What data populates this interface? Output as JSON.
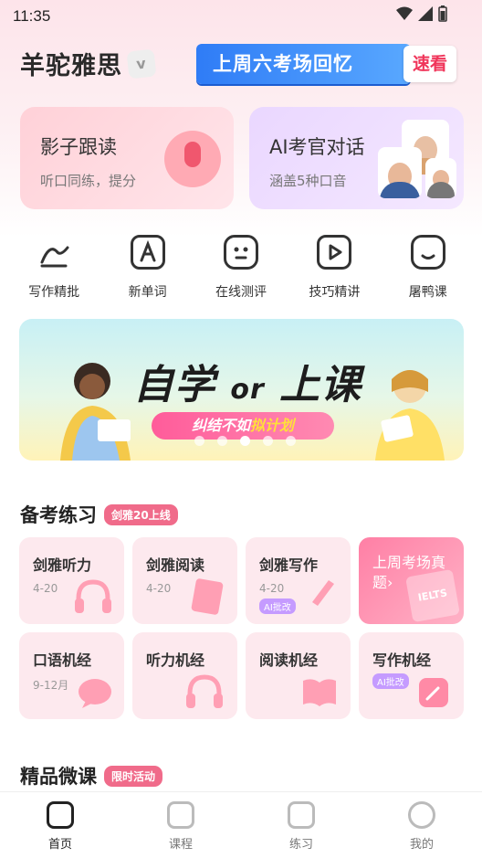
{
  "status": {
    "time": "11:35"
  },
  "header": {
    "brand": "羊驼雅思",
    "brand_badge": "v",
    "promo_main": "上周六考场回忆",
    "promo_side": "速看"
  },
  "cards": {
    "shadow": {
      "title": "影子跟读",
      "subtitle": "听口同练，提分"
    },
    "ai": {
      "title": "AI考官对话",
      "subtitle": "涵盖5种口音"
    }
  },
  "icons": [
    {
      "label": "写作精批"
    },
    {
      "label": "新单词"
    },
    {
      "label": "在线测评"
    },
    {
      "label": "技巧精讲"
    },
    {
      "label": "屠鸭课"
    }
  ],
  "banner": {
    "title_a": "自学",
    "title_or": "or",
    "title_b": "上课",
    "sub_a": "纠结不如",
    "sub_b": "拟计划",
    "active_dot": 3
  },
  "practice": {
    "title": "备考练习",
    "badge": "剑雅20上线",
    "tiles": [
      {
        "title": "剑雅听力",
        "sub": "4-20"
      },
      {
        "title": "剑雅阅读",
        "sub": "4-20"
      },
      {
        "title": "剑雅写作",
        "sub": "4-20",
        "tag": "AI批改"
      },
      {
        "title": "上周考场真题",
        "arrow": "›",
        "deco": "IELTS"
      },
      {
        "title": "口语机经",
        "sub": "9-12月"
      },
      {
        "title": "听力机经"
      },
      {
        "title": "阅读机经"
      },
      {
        "title": "写作机经",
        "tag": "AI批改"
      }
    ]
  },
  "micro": {
    "title": "精品微课",
    "badge": "限时活动"
  },
  "tabs": [
    {
      "label": "首页"
    },
    {
      "label": "课程"
    },
    {
      "label": "练习"
    },
    {
      "label": "我的"
    }
  ],
  "colors": {
    "accent": "#f06b8a",
    "brand_blue": "#2f7cf6"
  }
}
